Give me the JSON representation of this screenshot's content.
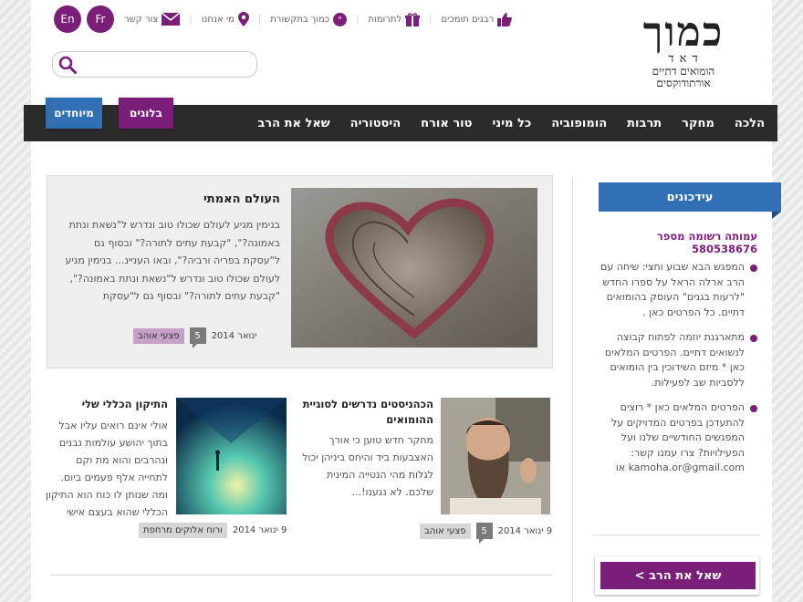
{
  "header": {
    "logo": {
      "big": "כמוך",
      "letters": "ד א ד",
      "tagline1": "הומואים דתיים",
      "tagline2": "אורתודוקסים"
    },
    "top_links": [
      {
        "icon": "envelope-icon",
        "label": "צור קשר"
      },
      {
        "icon": "location-pin-icon",
        "label": "מי אנחנו"
      },
      {
        "icon": "quote-icon",
        "label": "כמוך בתקשורת"
      },
      {
        "icon": "gift-icon",
        "label": "לתרומות"
      },
      {
        "icon": "thumbs-up-icon",
        "label": "רבנים תומכים"
      }
    ],
    "lang_fr": "Fr",
    "lang_en": "En",
    "search_placeholder": ""
  },
  "nav": {
    "items": [
      "הלכה",
      "מחקר",
      "תרבות",
      "הומופוביה",
      "כל מיני",
      "טור אורח",
      "היסטוריה",
      "שאל את הרב"
    ],
    "tab_blogs": "בלוגים",
    "tab_special": "מיוחדים"
  },
  "colors": {
    "purple": "#7b1e7a",
    "blue": "#2f6fb3",
    "nav_bg": "#2b2b2b"
  },
  "feature": {
    "title": "העולם האמתי",
    "text": "בנימין מגיע לעולם שכולו טוב ונדרש ל\"נשאת ונתת באמונה?\", \"קבעת עתים לתורה?\" ובסוף גם ל\"עסקת בפריה ורביה?\", ובאו העניינ... בנימין מגיע לעולם שכולו טוב ונדרש ל\"נשאת ונתת באמונה?\", \"קבעת עתים לתורה?\" ובסוף גם ל\"עסקת",
    "tag": "פצעי אוהב",
    "count": "5",
    "date": "ינואר 2014"
  },
  "posts": [
    {
      "title": "הכהניסטים נדרשים לסוגיית ההומואים",
      "text": "מחקר חדש טוען כי אורך האצבעות ביד והיחס ביניהן יכול לגלות מהי הנטייה המינית שלכם. לא נגענו!...",
      "tag": "פצעי אוהב",
      "count": "5",
      "date": "9 ינואר 2014"
    },
    {
      "title": "התיקון הכללי שלי",
      "text": "אולי אינם רואים עליו אבל בתוך יהושע עולמות נבנים ונהרבים והוא מת וקם לתחייה אלף פעמים ביום. ומה שנותן לו כוח הוא התיקון הכללי שהוא בעצם אישי",
      "tag": "ורוח אלוקים מרחפת",
      "date": "9 ינואר 2014"
    }
  ],
  "sidebar": {
    "heading": "עידכונים",
    "subheading": "עמותה רשומה מספר 580538676",
    "items": [
      "המפגש הבא שבוע וחצי: שיחה עם הרב ארלה הראל על ספרו החדש \"לרעות בגנים\" העוסק בהומואים דתיים. כל הפרטים כאן .",
      "מתארגנת יוזמה לפתוח קבוצה לנשואים דתיים. הפרטים המלאים כאן * מיזם השידוכין בין הומואים ללסביות שב לפעילות.",
      "הפרטים המלאים כאן * רוצים להתעדכן בפרטים המדויקים על המפגשים החודשיים שלנו ועל הפעילויות? צרו עמנו קשר: kamoha.or@gmail.com או"
    ],
    "ask_button": "שאל את הרב >"
  }
}
